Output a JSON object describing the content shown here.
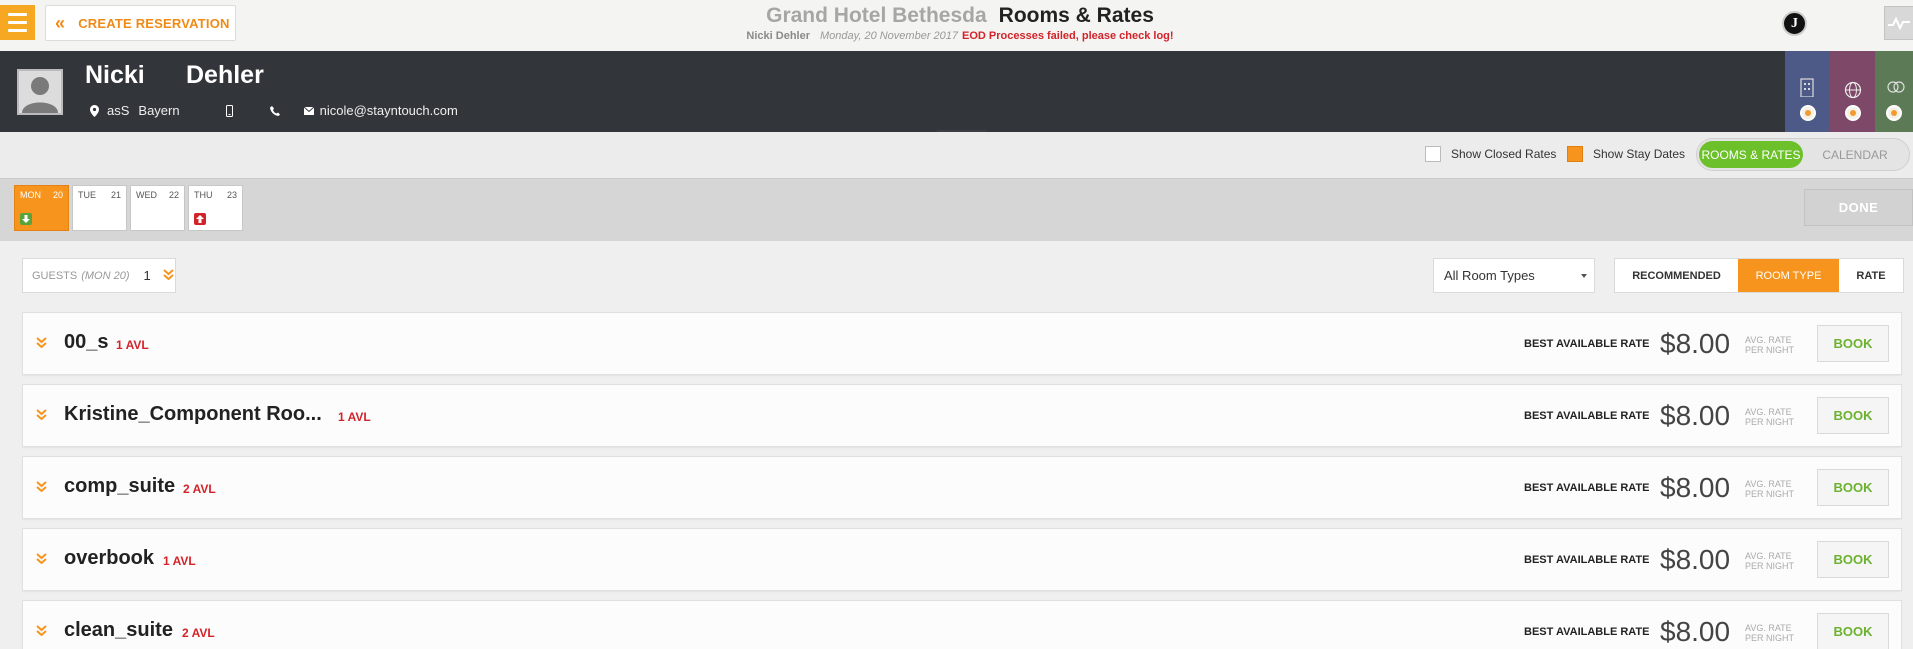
{
  "header": {
    "create_label": "CREATE RESERVATION",
    "hotel_name": "Grand Hotel Bethesda",
    "page_title": "Rooms & Rates",
    "user_name": "Nicki Dehler",
    "business_date": "Monday, 20 November 2017",
    "eod_error": "EOD Processes failed, please check log!",
    "logo_letter": "J"
  },
  "guest": {
    "first_name": "Nicki",
    "last_name": "Dehler",
    "city": "asS",
    "state": "Bayern",
    "email": "nicole@stayntouch.com"
  },
  "side_tab_colors": [
    "#4d5a87",
    "#7e4968",
    "#5c7a55"
  ],
  "filters": {
    "show_closed_rates": "Show Closed Rates",
    "show_stay_dates": "Show Stay Dates",
    "view_rooms_rates": "ROOMS & RATES",
    "view_calendar": "CALENDAR"
  },
  "dates": [
    {
      "day": "MON",
      "date": "20",
      "active": true,
      "marker": "arrival"
    },
    {
      "day": "TUE",
      "date": "21",
      "active": false,
      "marker": ""
    },
    {
      "day": "WED",
      "date": "22",
      "active": false,
      "marker": ""
    },
    {
      "day": "THU",
      "date": "23",
      "active": false,
      "marker": "departure"
    }
  ],
  "done_label": "DONE",
  "guests": {
    "label": "GUESTS",
    "sub": "(MON 20)",
    "count": "1"
  },
  "room_type_select": "All Room Types",
  "sort_tabs": {
    "recommended": "RECOMMENDED",
    "room_type": "ROOM TYPE",
    "rate": "RATE"
  },
  "rooms": [
    {
      "name": "00_s",
      "avl": "1 AVL",
      "rate_label": "BEST AVAILABLE RATE",
      "price": "$8.00",
      "avg1": "AVG. RATE",
      "avg2": "PER NIGHT",
      "book": "BOOK"
    },
    {
      "name": "Kristine_Component Roo...",
      "avl": "1 AVL",
      "rate_label": "BEST AVAILABLE RATE",
      "price": "$8.00",
      "avg1": "AVG. RATE",
      "avg2": "PER NIGHT",
      "book": "BOOK"
    },
    {
      "name": "comp_suite",
      "avl": "2 AVL",
      "rate_label": "BEST AVAILABLE RATE",
      "price": "$8.00",
      "avg1": "AVG. RATE",
      "avg2": "PER NIGHT",
      "book": "BOOK"
    },
    {
      "name": "overbook",
      "avl": "1 AVL",
      "rate_label": "BEST AVAILABLE RATE",
      "price": "$8.00",
      "avg1": "AVG. RATE",
      "avg2": "PER NIGHT",
      "book": "BOOK"
    },
    {
      "name": "clean_suite",
      "avl": "2 AVL",
      "rate_label": "BEST AVAILABLE RATE",
      "price": "$8.00",
      "avg1": "AVG. RATE",
      "avg2": "PER NIGHT",
      "book": "BOOK"
    }
  ],
  "colors": {
    "accent": "#f7941d",
    "success": "#6cc02a",
    "error": "#d3232a",
    "dark_band": "#32363a"
  }
}
